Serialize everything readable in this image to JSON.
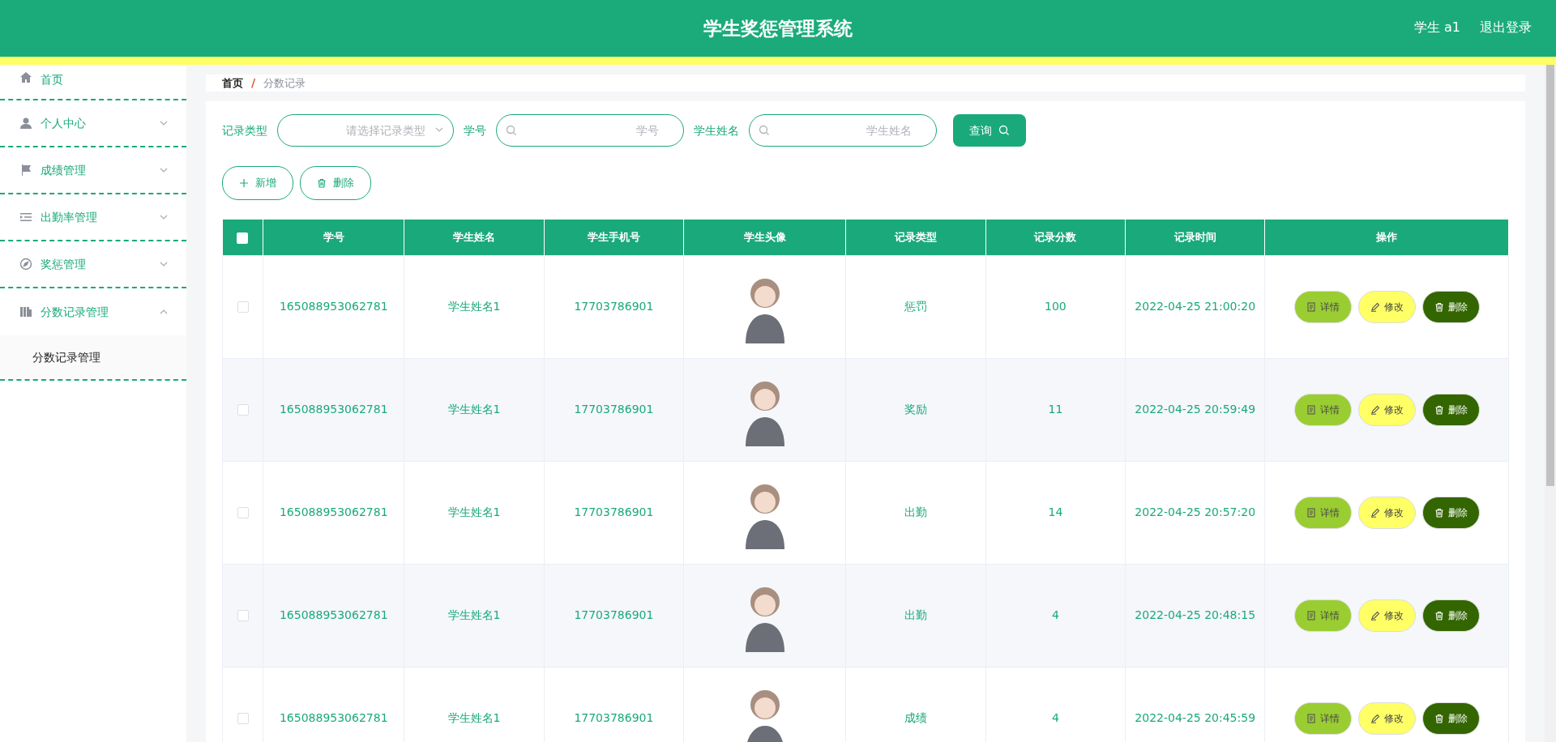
{
  "header": {
    "title": "学生奖惩管理系统",
    "user": "学生 a1",
    "logout": "退出登录"
  },
  "sidebar": {
    "items": [
      {
        "label": "首页"
      },
      {
        "label": "个人中心",
        "expanded": false
      },
      {
        "label": "成绩管理",
        "expanded": false
      },
      {
        "label": "出勤率管理",
        "expanded": false
      },
      {
        "label": "奖惩管理",
        "expanded": false
      },
      {
        "label": "分数记录管理",
        "expanded": true,
        "children": [
          {
            "label": "分数记录管理"
          }
        ]
      }
    ]
  },
  "breadcrumb": [
    "首页",
    "分数记录"
  ],
  "breadcrumb_separator": "/",
  "filters": {
    "record_type": {
      "label": "记录类型",
      "placeholder": "请选择记录类型"
    },
    "student_id": {
      "label": "学号",
      "placeholder": "学号"
    },
    "student_name": {
      "label": "学生姓名",
      "placeholder": "学生姓名"
    },
    "search_button": "查询"
  },
  "actions": [
    "新增",
    "删除"
  ],
  "table": {
    "header_checkbox": {
      "checked": false
    },
    "columns": [
      "学号",
      "学生姓名",
      "学生手机号",
      "学生头像",
      "记录类型",
      "记录分数",
      "记录时间",
      "操作"
    ],
    "rows": [
      {
        "checked": false,
        "id": "165088953062781",
        "name": "学生姓名1",
        "phone": "17703786901",
        "type": "惩罚",
        "score": "100",
        "time": "2022-04-25 21:00:20",
        "buttons": [
          "详情",
          "修改",
          "删除"
        ]
      },
      {
        "checked": false,
        "id": "165088953062781",
        "name": "学生姓名1",
        "phone": "17703786901",
        "type": "奖励",
        "score": "11",
        "time": "2022-04-25 20:59:49",
        "buttons": [
          "详情",
          "修改",
          "删除"
        ]
      },
      {
        "checked": false,
        "id": "165088953062781",
        "name": "学生姓名1",
        "phone": "17703786901",
        "type": "出勤",
        "score": "14",
        "time": "2022-04-25 20:57:20",
        "buttons": [
          "详情",
          "修改",
          "删除"
        ]
      },
      {
        "checked": false,
        "id": "165088953062781",
        "name": "学生姓名1",
        "phone": "17703786901",
        "type": "出勤",
        "score": "4",
        "time": "2022-04-25 20:48:15",
        "buttons": [
          "详情",
          "修改",
          "删除"
        ]
      },
      {
        "checked": false,
        "id": "165088953062781",
        "name": "学生姓名1",
        "phone": "17703786901",
        "type": "成绩",
        "score": "4",
        "time": "2022-04-25 20:45:59",
        "buttons": [
          "详情",
          "修改",
          "删除"
        ]
      }
    ]
  }
}
